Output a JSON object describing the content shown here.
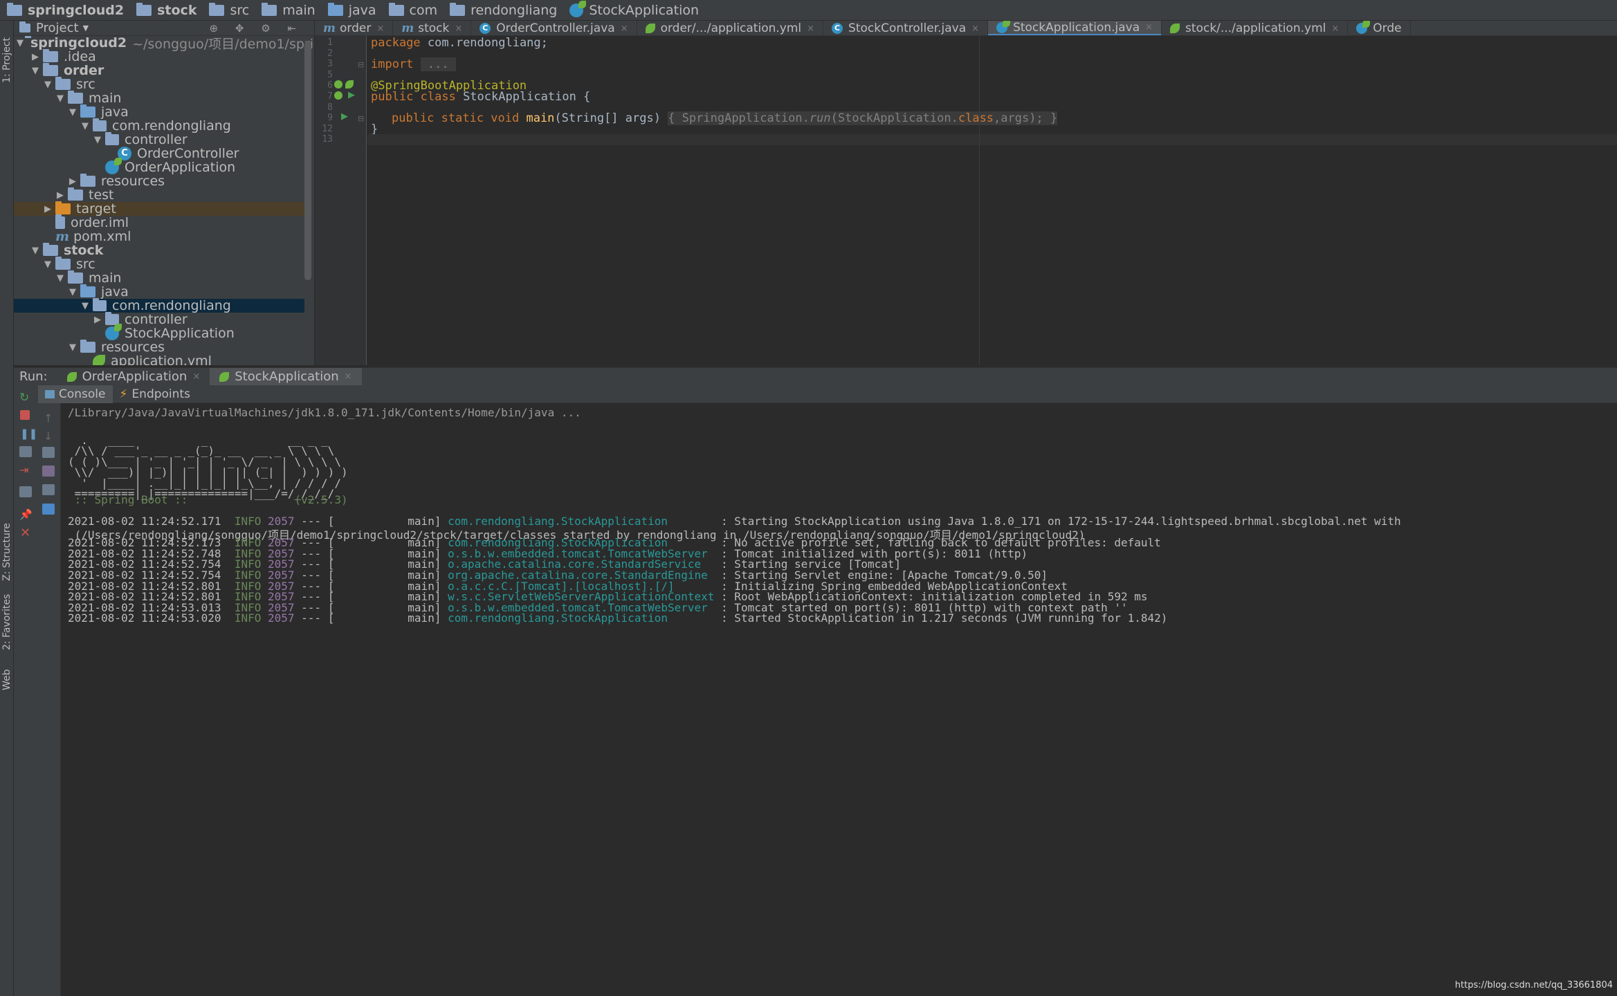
{
  "navbar": {
    "crumbs": [
      "springcloud2",
      "stock",
      "src",
      "main",
      "java",
      "com",
      "rendongliang",
      "StockApplication"
    ]
  },
  "sidebar": {
    "vtab_project": "1: Project",
    "vtab_structure": "Z: Structure",
    "vtab_favorites": "2: Favorites",
    "vtab_web": "Web"
  },
  "project": {
    "header": "Project",
    "root_name": "springcloud2",
    "root_path": "~/songguo/项目/demo1/springcloud2",
    "items": [
      ".idea",
      "order",
      "src",
      "main",
      "java",
      "com.rendongliang",
      "controller",
      "OrderController",
      "OrderApplication",
      "resources",
      "test",
      "target",
      "order.iml",
      "pom.xml",
      "stock",
      "src",
      "main",
      "java",
      "com.rendongliang",
      "controller",
      "StockApplication",
      "resources",
      "application.yml"
    ]
  },
  "tabs": [
    "order",
    "stock",
    "OrderController.java",
    "order/.../application.yml",
    "StockController.java",
    "StockApplication.java",
    "stock/.../application.yml",
    "Orde"
  ],
  "editor": {
    "line_numbers": [
      "1",
      "2",
      "3",
      "5",
      "6",
      "7",
      "8",
      "9",
      "12",
      "13"
    ],
    "kw_package": "package",
    "pkg_name": " com.rendongliang;",
    "kw_import": "import",
    "import_fold": " ... ",
    "annotation": "@SpringBootApplication",
    "kw_public_class": "public class",
    "class_decl": " StockApplication {",
    "kw_main_mods": "public static void",
    "main_name": " main",
    "main_params": "(String[] args) ",
    "main_body_open": "{ ",
    "main_body_call": "SpringApplication.",
    "main_body_run": "run",
    "main_body_args": "(StockApplication.",
    "kw_class": "class",
    "main_body_end": ",args); ",
    "main_body_close": "}",
    "class_close": "}"
  },
  "run": {
    "label": "Run:",
    "tabs": [
      "OrderApplication",
      "StockApplication"
    ],
    "subtabs": [
      "Console",
      "Endpoints"
    ]
  },
  "console": {
    "cmd": "/Library/Java/JavaVirtualMachines/jdk1.8.0_171.jdk/Contents/Home/bin/java ...",
    "banner": [
      "  .   ____          _            __ _ _",
      " /\\\\ / ___'_ __ _ _(_)_ __  __ _ \\ \\ \\ \\",
      "( ( )\\___ | '_ | '_| | '_ \\/ _` | \\ \\ \\ \\",
      " \\\\/  ___)| |_)| | | | | || (_| |  ) ) ) )",
      "  '  |____| .__|_| |_|_| |_\\__, | / / / /",
      " =========|_|==============|___/=/_/_/_/",
      " :: Spring Boot ::                (v2.5.3)"
    ],
    "logs": [
      {
        "ts": "2021-08-02 11:24:52.171",
        "lvl": "INFO",
        "pid": "2057",
        "thread": " --- [           main] ",
        "logger": "com.rendongliang.StockApplication       ",
        "msg": " : Starting StockApplication using Java 1.8.0_171 on 172-15-17-244.lightspeed.brhmal.sbcglobal.net with"
      },
      {
        "cont": " (/Users/rendongliang/songguo/项目/demo1/springcloud2/stock/target/classes started by rendongliang in /Users/rendongliang/songguo/项目/demo1/springcloud2)"
      },
      {
        "ts": "2021-08-02 11:24:52.173",
        "lvl": "INFO",
        "pid": "2057",
        "thread": " --- [           main] ",
        "logger": "com.rendongliang.StockApplication       ",
        "msg": " : No active profile set, falling back to default profiles: default"
      },
      {
        "ts": "2021-08-02 11:24:52.748",
        "lvl": "INFO",
        "pid": "2057",
        "thread": " --- [           main] ",
        "logger": "o.s.b.w.embedded.tomcat.TomcatWebServer ",
        "msg": " : Tomcat initialized with port(s): 8011 (http)"
      },
      {
        "ts": "2021-08-02 11:24:52.754",
        "lvl": "INFO",
        "pid": "2057",
        "thread": " --- [           main] ",
        "logger": "o.apache.catalina.core.StandardService  ",
        "msg": " : Starting service [Tomcat]"
      },
      {
        "ts": "2021-08-02 11:24:52.754",
        "lvl": "INFO",
        "pid": "2057",
        "thread": " --- [           main] ",
        "logger": "org.apache.catalina.core.StandardEngine ",
        "msg": " : Starting Servlet engine: [Apache Tomcat/9.0.50]"
      },
      {
        "ts": "2021-08-02 11:24:52.801",
        "lvl": "INFO",
        "pid": "2057",
        "thread": " --- [           main] ",
        "logger": "o.a.c.c.C.[Tomcat].[localhost].[/]      ",
        "msg": " : Initializing Spring embedded WebApplicationContext"
      },
      {
        "ts": "2021-08-02 11:24:52.801",
        "lvl": "INFO",
        "pid": "2057",
        "thread": " --- [           main] ",
        "logger": "w.s.c.ServletWebServerApplicationContext",
        "msg": " : Root WebApplicationContext: initialization completed in 592 ms"
      },
      {
        "ts": "2021-08-02 11:24:53.013",
        "lvl": "INFO",
        "pid": "2057",
        "thread": " --- [           main] ",
        "logger": "o.s.b.w.embedded.tomcat.TomcatWebServer ",
        "msg": " : Tomcat started on port(s): 8011 (http) with context path ''"
      },
      {
        "ts": "2021-08-02 11:24:53.020",
        "lvl": "INFO",
        "pid": "2057",
        "thread": " --- [           main] ",
        "logger": "com.rendongliang.StockApplication       ",
        "msg": " : Started StockApplication in 1.217 seconds (JVM running for 1.842)"
      }
    ]
  },
  "watermark": "https://blog.csdn.net/qq_33661804",
  "colors": {
    "accent": "#4a88c7",
    "spring": "#6db33f",
    "selection": "#0d293e",
    "keyword": "#cc7832",
    "annotation": "#bbb529"
  }
}
